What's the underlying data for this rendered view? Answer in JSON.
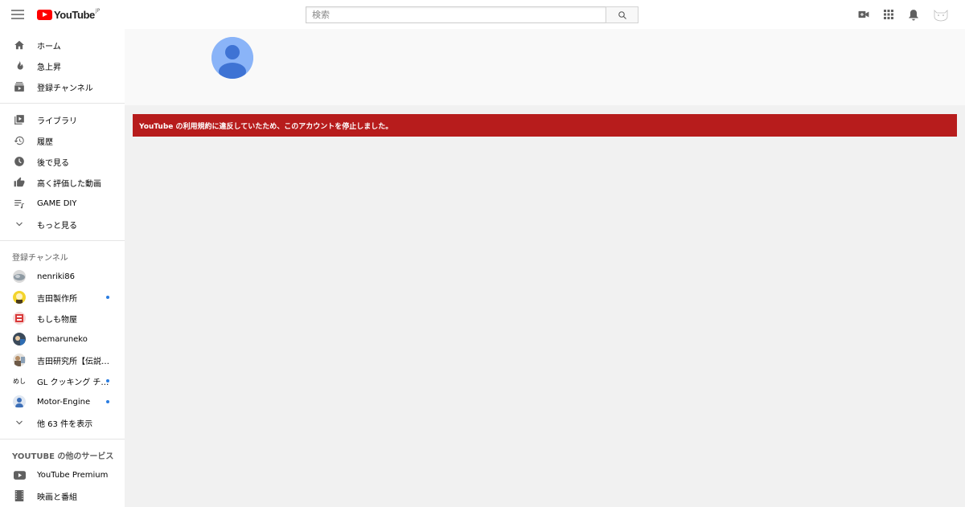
{
  "header": {
    "logo_text": "YouTube",
    "logo_region": "JP",
    "search_placeholder": "検索",
    "colors": {
      "brand": "#ff0000",
      "alert": "#b71c1c",
      "notify_dot": "#2a7de1",
      "avatar": "#8ab4f8"
    }
  },
  "nav_main": [
    {
      "label": "ホーム",
      "icon": "home-icon"
    },
    {
      "label": "急上昇",
      "icon": "trending-icon"
    },
    {
      "label": "登録チャンネル",
      "icon": "subscriptions-icon"
    }
  ],
  "nav_library": [
    {
      "label": "ライブラリ",
      "icon": "library-icon"
    },
    {
      "label": "履歴",
      "icon": "history-icon"
    },
    {
      "label": "後で見る",
      "icon": "watch-later-icon"
    },
    {
      "label": "高く評価した動画",
      "icon": "liked-icon"
    },
    {
      "label": "GAME DIY",
      "icon": "playlist-icon"
    },
    {
      "label": "もっと見る",
      "icon": "chevron-down-icon"
    }
  ],
  "subscriptions": {
    "title": "登録チャンネル",
    "channels": [
      {
        "label": "nenriki86",
        "has_new": false
      },
      {
        "label": "吉田製作所",
        "has_new": true
      },
      {
        "label": "もしも物屋",
        "has_new": false
      },
      {
        "label": "bemaruneko",
        "has_new": false
      },
      {
        "label": "吉田研究所【伝説の…",
        "has_new": false
      },
      {
        "label": "GL クッキング チ…",
        "avatar_text": "めし",
        "has_new": true
      },
      {
        "label": "Motor-Engine",
        "has_new": true
      }
    ],
    "show_more": "他 63 件を表示"
  },
  "more_services": {
    "title": "YOUTUBE の他のサービス",
    "items": [
      {
        "label": "YouTube Premium",
        "icon": "youtube-premium-icon"
      },
      {
        "label": "映画と番組",
        "icon": "film-icon"
      }
    ]
  },
  "main": {
    "alert_text": "YouTube の利用規約に違反していたため、このアカウントを停止しました。"
  }
}
